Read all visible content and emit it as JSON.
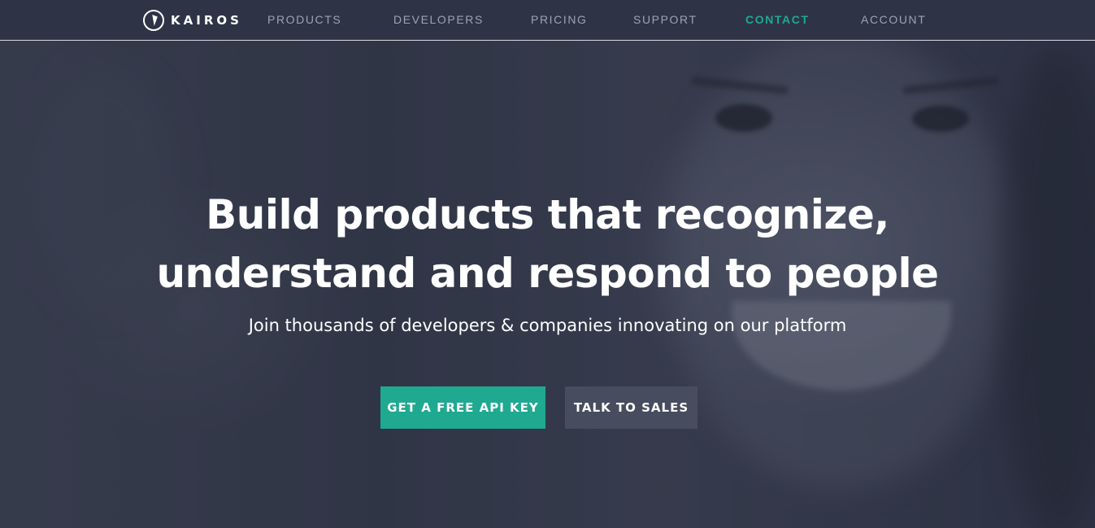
{
  "brand": {
    "name": "KAIROS",
    "logo_icon": "kairos-logo-icon"
  },
  "nav": {
    "items": [
      {
        "label": "PRODUCTS",
        "active": false
      },
      {
        "label": "DEVELOPERS",
        "active": false
      },
      {
        "label": "PRICING",
        "active": false
      },
      {
        "label": "SUPPORT",
        "active": false
      },
      {
        "label": "CONTACT",
        "active": true
      },
      {
        "label": "ACCOUNT",
        "active": false
      }
    ]
  },
  "hero": {
    "headline_line1": "Build products that recognize,",
    "headline_line2": "understand and respond to people",
    "subheadline": "Join thousands of developers & companies innovating on our platform",
    "primary_button": "GET A FREE API KEY",
    "secondary_button": "TALK TO SALES"
  },
  "colors": {
    "background": "#2e3446",
    "accent": "#1fa990",
    "secondary_button": "#474d5e",
    "nav_text": "#9ea3b0"
  }
}
